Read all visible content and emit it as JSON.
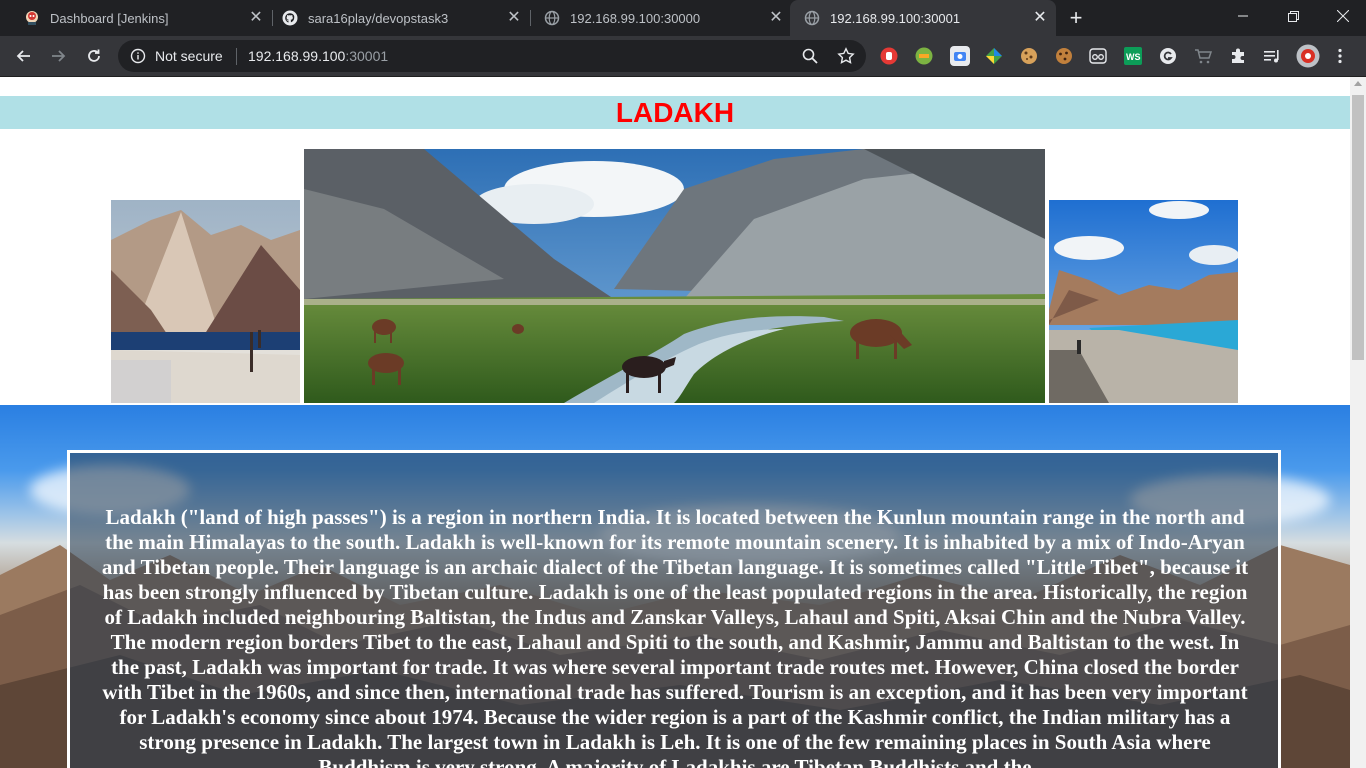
{
  "browser": {
    "tabs": [
      {
        "title": "Dashboard [Jenkins]",
        "icon": "jenkins-icon",
        "active": false
      },
      {
        "title": "sara16play/devopstask3",
        "icon": "github-icon",
        "active": false
      },
      {
        "title": "192.168.99.100:30000",
        "icon": "globe-icon",
        "active": false
      },
      {
        "title": "192.168.99.100:30001",
        "icon": "globe-icon",
        "active": true
      }
    ],
    "security_label": "Not secure",
    "url_host": "192.168.99.100",
    "url_port": ":30001"
  },
  "page": {
    "heading": "LADAKH",
    "description": "Ladakh (\"land of high passes\") is a region in northern India. It is located between the Kunlun mountain range in the north and the main Himalayas to the south. Ladakh is well-known for its remote mountain scenery. It is inhabited by a mix of Indo-Aryan and Tibetan people. Their language is an archaic dialect of the Tibetan language. It is sometimes called \"Little Tibet\", because it has been strongly influenced by Tibetan culture. Ladakh is one of the least populated regions in the area. Historically, the region of Ladakh included neighbouring Baltistan, the Indus and Zanskar Valleys, Lahaul and Spiti, Aksai Chin and the Nubra Valley. The modern region borders Tibet to the east, Lahaul and Spiti to the south, and Kashmir, Jammu and Baltistan to the west. In the past, Ladakh was important for trade. It was where several important trade routes met. However, China closed the border with Tibet in the 1960s, and since then, international trade has suffered. Tourism is an exception, and it has been very important for Ladakh's economy since about 1974. Because the wider region is a part of the Kashmir conflict, the Indian military has a strong presence in Ladakh. The largest town in Ladakh is Leh. It is one of the few remaining places in South Asia where Buddhism is very strong. A majority of Ladakhis are Tibetan Buddhists and the"
  },
  "colors": {
    "heading_text": "#ff0000",
    "banner_bg": "#b0e0e6",
    "tabstrip_bg": "#202124",
    "toolbar_bg": "#35363a"
  }
}
